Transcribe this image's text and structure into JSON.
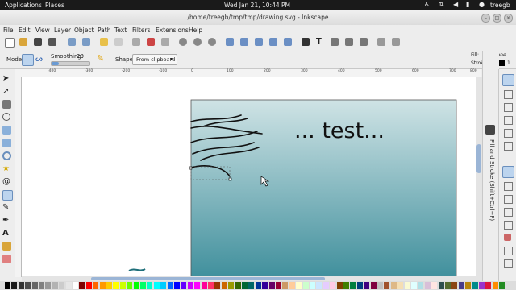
{
  "gnome_panel": {
    "applications": "Applications",
    "places": "Places",
    "clock": "Wed Jan 21, 10:44 PM",
    "user": "treegb"
  },
  "window": {
    "title": "/home/treegb/tmp/tmp/drawing.svg - Inkscape"
  },
  "menu": [
    "File",
    "Edit",
    "View",
    "Layer",
    "Object",
    "Path",
    "Text",
    "Filters",
    "Extensions",
    "Help"
  ],
  "tool_controls": {
    "mode_label": "Mode:",
    "smoothing_label": "Smoothing:",
    "smoothing_value": "20",
    "smoothing_fraction": 0.2,
    "shape_label": "Shape:",
    "shape_value": "From clipboard"
  },
  "style_indicator": {
    "fill_label": "Fill:",
    "fill_value": "None",
    "stroke_label": "Stroke:",
    "stroke_width": "1"
  },
  "ruler": {
    "h_ticks": [
      "-400",
      "-300",
      "-200",
      "-100",
      "0",
      "100",
      "200",
      "300",
      "400",
      "500",
      "600",
      "700",
      "800"
    ]
  },
  "canvas": {
    "text": "...   test..."
  },
  "docked_dialog": {
    "title": "Fill and Stroke (Shift+Ctrl+F)"
  },
  "colors": {
    "page_gradient_top": "#cfe3e5",
    "page_gradient_bottom": "#3f8f9c",
    "palette": [
      "#000000",
      "#1a1a1a",
      "#333333",
      "#4d4d4d",
      "#666666",
      "#808080",
      "#999999",
      "#b3b3b3",
      "#cccccc",
      "#e6e6e6",
      "#ffffff",
      "#800000",
      "#ff0000",
      "#ff6600",
      "#ff9900",
      "#ffcc00",
      "#ffff00",
      "#ccff00",
      "#66ff00",
      "#00ff00",
      "#00ff66",
      "#00ffcc",
      "#00ffff",
      "#00ccff",
      "#0066ff",
      "#0000ff",
      "#6600ff",
      "#cc00ff",
      "#ff00ff",
      "#ff0099",
      "#ff3366",
      "#993300",
      "#cc6600",
      "#999900",
      "#336600",
      "#006633",
      "#006666",
      "#003399",
      "#330099",
      "#660066",
      "#990033",
      "#cc9966",
      "#ffcc99",
      "#ffffcc",
      "#ccffcc",
      "#ccffff",
      "#cce5ff",
      "#e5ccff",
      "#ffcce5",
      "#804000",
      "#408000",
      "#008040",
      "#004080",
      "#400080",
      "#800040",
      "#c0c0c0",
      "#a0522d",
      "#deb887",
      "#f5deb3",
      "#fafad2",
      "#e0ffff",
      "#b0e0e6",
      "#d8bfd8",
      "#ffe4e1",
      "#2f4f4f",
      "#556b2f",
      "#8b4513",
      "#483d8b",
      "#b8860b",
      "#008b8b",
      "#9932cc",
      "#dc143c",
      "#ff8c00",
      "#228b22"
    ]
  }
}
